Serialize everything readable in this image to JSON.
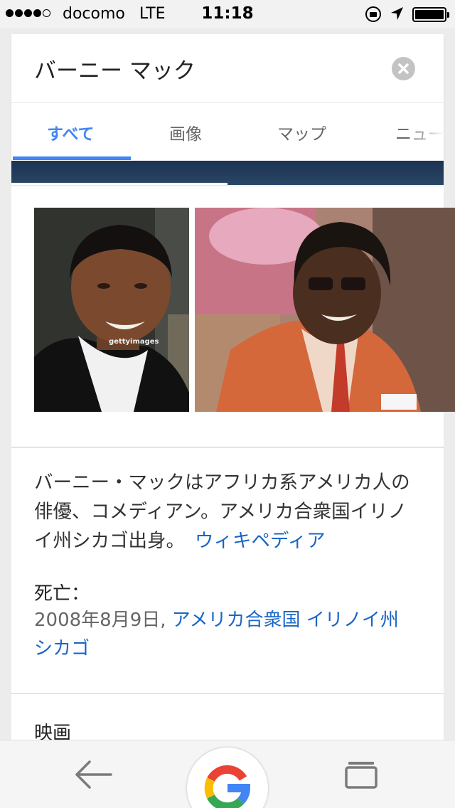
{
  "status_bar": {
    "carrier": "docomo",
    "network": "LTE",
    "time": "11:18",
    "signal_bars_filled": 4,
    "signal_bars_total": 5,
    "battery_level": 1.0
  },
  "search": {
    "query": "バーニー マック",
    "tabs": [
      {
        "label": "すべて",
        "active": true
      },
      {
        "label": "画像",
        "active": false
      },
      {
        "label": "マップ",
        "active": false
      },
      {
        "label": "ニュー",
        "active": false
      }
    ]
  },
  "knowledge_panel": {
    "image1_watermark": "gettyimages",
    "description": "バーニー・マックはアフリカ系アメリカ人の俳優、コメディアン。アメリカ合衆国イリノイ州シカゴ出身。",
    "source_link": "ウィキペディア",
    "death_label": "死亡：",
    "death_date": "2008年8月9日,",
    "death_place": "アメリカ合衆国 イリノイ州 シカゴ",
    "films_heading": "映画"
  },
  "colors": {
    "accent": "#4285f4",
    "link": "#1a65c7",
    "header_strip": "#1c3352"
  },
  "icons": {
    "clear": "clear-icon",
    "back": "back-arrow-icon",
    "google": "google-g-icon",
    "tabs": "tabs-icon"
  }
}
